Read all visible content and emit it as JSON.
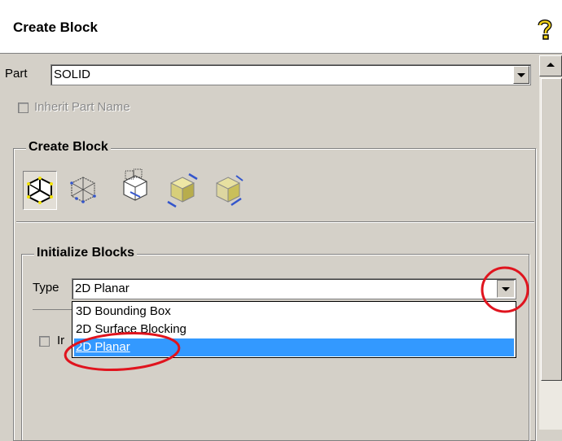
{
  "header": {
    "title": "Create Block",
    "help_icon": "help-question-icon"
  },
  "part": {
    "label": "Part",
    "value": "SOLID"
  },
  "inherit": {
    "label": "Inherit Part Name",
    "checked": false,
    "disabled": true
  },
  "create_block_group": {
    "title": "Create Block",
    "icons": [
      "create-block-3d-icon",
      "create-block-2d-wire-icon",
      "create-block-grid-icon",
      "extrude-block-icon",
      "extrude-face-icon"
    ]
  },
  "init_group": {
    "title": "Initialize Blocks",
    "type_label": "Type",
    "type_value": "2D Planar",
    "options": [
      "3D Bounding Box",
      "2D Surface Blocking",
      "2D Planar"
    ],
    "selected_index": 2,
    "hidden_checkbox_label_fragment": "Ir"
  },
  "colors": {
    "highlight": "#3399ff",
    "annotation": "#e0141e",
    "panel": "#d4d0c8"
  }
}
